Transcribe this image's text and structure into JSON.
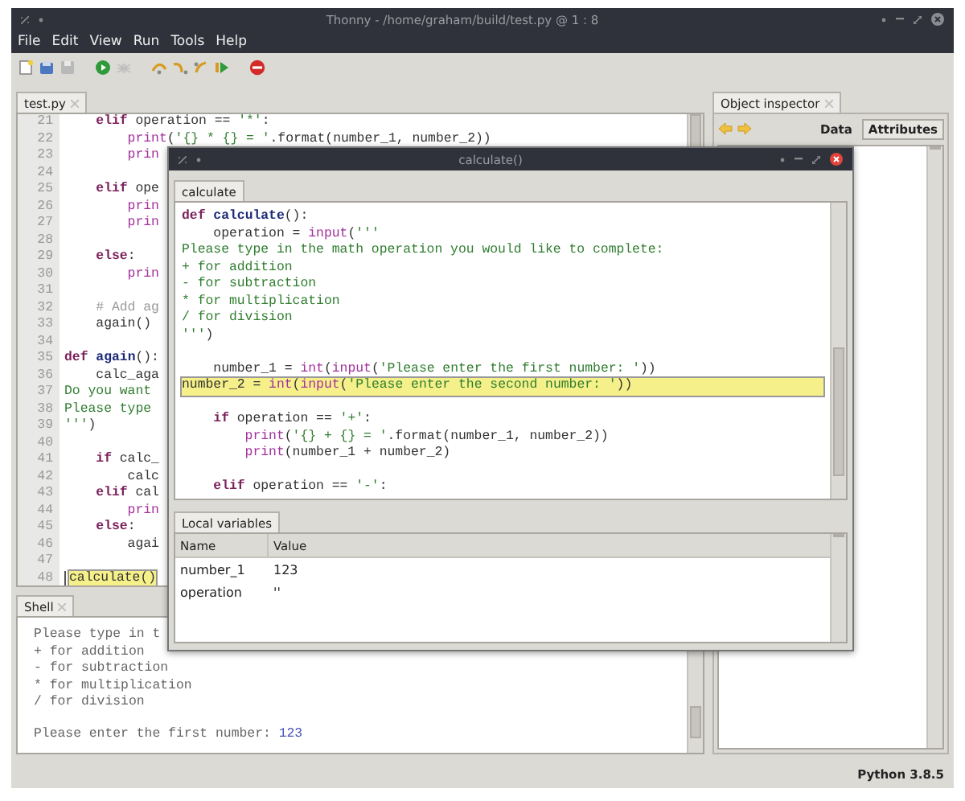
{
  "window": {
    "title": "Thonny - /home/graham/build/test.py @ 1 : 8"
  },
  "menu": [
    "File",
    "Edit",
    "View",
    "Run",
    "Tools",
    "Help"
  ],
  "editor": {
    "tab": "test.py",
    "lines": [
      {
        "number": "21",
        "highlighted": false,
        "tokens": [
          {
            "kind": "keyword",
            "text": "    elif"
          },
          {
            "kind": "plain",
            "text": " operation == "
          },
          {
            "kind": "string",
            "text": "'*'"
          },
          {
            "kind": "plain",
            "text": ":"
          }
        ]
      },
      {
        "number": "22",
        "highlighted": false,
        "tokens": [
          {
            "kind": "builtin",
            "text": "        print"
          },
          {
            "kind": "plain",
            "text": "("
          },
          {
            "kind": "string",
            "text": "'{} * {} = '"
          },
          {
            "kind": "plain",
            "text": ".format(number_1, number_2))"
          }
        ]
      },
      {
        "number": "23",
        "highlighted": false,
        "tokens": [
          {
            "kind": "builtin",
            "text": "        prin"
          }
        ]
      },
      {
        "number": "24",
        "highlighted": false
      },
      {
        "number": "25",
        "highlighted": false,
        "tokens": [
          {
            "kind": "keyword",
            "text": "    elif"
          },
          {
            "kind": "plain",
            "text": " ope"
          }
        ]
      },
      {
        "number": "26",
        "highlighted": false,
        "tokens": [
          {
            "kind": "builtin",
            "text": "        prin"
          }
        ]
      },
      {
        "number": "27",
        "highlighted": false,
        "tokens": [
          {
            "kind": "builtin",
            "text": "        prin"
          }
        ]
      },
      {
        "number": "28",
        "highlighted": false
      },
      {
        "number": "29",
        "highlighted": false,
        "tokens": [
          {
            "kind": "keyword",
            "text": "    else"
          },
          {
            "kind": "plain",
            "text": ":"
          }
        ]
      },
      {
        "number": "30",
        "highlighted": false,
        "tokens": [
          {
            "kind": "builtin",
            "text": "        prin"
          }
        ]
      },
      {
        "number": "31",
        "highlighted": false
      },
      {
        "number": "32",
        "highlighted": false,
        "tokens": [
          {
            "kind": "comment",
            "text": "    # Add ag"
          }
        ]
      },
      {
        "number": "33",
        "highlighted": false,
        "tokens": [
          {
            "kind": "plain",
            "text": "    again()"
          }
        ]
      },
      {
        "number": "34",
        "highlighted": false
      },
      {
        "number": "35",
        "highlighted": false,
        "tokens": [
          {
            "kind": "keyword",
            "text": "def"
          },
          {
            "kind": "defname",
            "text": " again"
          },
          {
            "kind": "plain",
            "text": "():"
          }
        ]
      },
      {
        "number": "36",
        "highlighted": false,
        "tokens": [
          {
            "kind": "plain",
            "text": "    calc_aga"
          }
        ]
      },
      {
        "number": "37",
        "highlighted": false,
        "tokens": [
          {
            "kind": "string",
            "text": "Do you want"
          }
        ]
      },
      {
        "number": "38",
        "highlighted": false,
        "tokens": [
          {
            "kind": "string",
            "text": "Please type"
          }
        ]
      },
      {
        "number": "39",
        "highlighted": false,
        "tokens": [
          {
            "kind": "string",
            "text": "'''"
          },
          {
            "kind": "plain",
            "text": ")"
          }
        ]
      },
      {
        "number": "40",
        "highlighted": false
      },
      {
        "number": "41",
        "highlighted": false,
        "tokens": [
          {
            "kind": "keyword",
            "text": "    if"
          },
          {
            "kind": "plain",
            "text": " calc_"
          }
        ]
      },
      {
        "number": "42",
        "highlighted": false,
        "tokens": [
          {
            "kind": "plain",
            "text": "        calc"
          }
        ]
      },
      {
        "number": "43",
        "highlighted": false,
        "tokens": [
          {
            "kind": "keyword",
            "text": "    elif"
          },
          {
            "kind": "plain",
            "text": " cal"
          }
        ]
      },
      {
        "number": "44",
        "highlighted": false,
        "tokens": [
          {
            "kind": "builtin",
            "text": "        prin"
          }
        ]
      },
      {
        "number": "45",
        "highlighted": false,
        "tokens": [
          {
            "kind": "keyword",
            "text": "    else"
          },
          {
            "kind": "plain",
            "text": ":"
          }
        ]
      },
      {
        "number": "46",
        "highlighted": false,
        "tokens": [
          {
            "kind": "plain",
            "text": "        agai"
          }
        ]
      },
      {
        "number": "47",
        "highlighted": false
      },
      {
        "number": "48",
        "highlighted": true,
        "tokens": [
          {
            "kind": "plain",
            "text": "calculate()"
          }
        ]
      }
    ]
  },
  "shell": {
    "tab": "Shell",
    "lines": [
      {
        "kind": "output",
        "text": "Please type in t"
      },
      {
        "kind": "output",
        "text": "+ for addition"
      },
      {
        "kind": "output",
        "text": "- for subtraction"
      },
      {
        "kind": "output",
        "text": "* for multiplication"
      },
      {
        "kind": "output",
        "text": "/ for division"
      },
      {
        "kind": "blank"
      },
      {
        "kind": "output",
        "text": "Please enter the first number: ",
        "input": "123"
      }
    ]
  },
  "object_inspector": {
    "tab": "Object inspector",
    "views": [
      {
        "label": "Data",
        "selected": false
      },
      {
        "label": "Attributes",
        "selected": true
      }
    ]
  },
  "status_bar": "Python 3.8.5",
  "frame_window": {
    "title": "calculate()",
    "tab": "calculate",
    "lines": [
      {
        "highlighted": false,
        "tokens": [
          {
            "kind": "keyword",
            "text": "def"
          },
          {
            "kind": "defname",
            "text": " calculate"
          },
          {
            "kind": "plain",
            "text": "():"
          }
        ]
      },
      {
        "highlighted": false,
        "tokens": [
          {
            "kind": "plain",
            "text": "    operation = "
          },
          {
            "kind": "builtin",
            "text": "input"
          },
          {
            "kind": "plain",
            "text": "("
          },
          {
            "kind": "string",
            "text": "'''"
          }
        ]
      },
      {
        "highlighted": false,
        "tokens": [
          {
            "kind": "string",
            "text": "Please type in the math operation you would like to complete:"
          }
        ]
      },
      {
        "highlighted": false,
        "tokens": [
          {
            "kind": "string",
            "text": "+ for addition"
          }
        ]
      },
      {
        "highlighted": false,
        "tokens": [
          {
            "kind": "string",
            "text": "- for subtraction"
          }
        ]
      },
      {
        "highlighted": false,
        "tokens": [
          {
            "kind": "string",
            "text": "* for multiplication"
          }
        ]
      },
      {
        "highlighted": false,
        "tokens": [
          {
            "kind": "string",
            "text": "/ for division"
          }
        ]
      },
      {
        "highlighted": false,
        "tokens": [
          {
            "kind": "string",
            "text": "'''"
          },
          {
            "kind": "plain",
            "text": ")"
          }
        ]
      },
      {
        "highlighted": false
      },
      {
        "highlighted": false,
        "tokens": [
          {
            "kind": "plain",
            "text": "    number_1 = "
          },
          {
            "kind": "builtin",
            "text": "int"
          },
          {
            "kind": "plain",
            "text": "("
          },
          {
            "kind": "builtin",
            "text": "input"
          },
          {
            "kind": "plain",
            "text": "("
          },
          {
            "kind": "string",
            "text": "'Please enter the first number: '"
          },
          {
            "kind": "plain",
            "text": "))"
          }
        ]
      },
      {
        "highlighted": true,
        "tokens": [
          {
            "kind": "plain",
            "text": "number_2 = "
          },
          {
            "kind": "builtin",
            "text": "int"
          },
          {
            "kind": "plain",
            "text": "("
          },
          {
            "kind": "builtin",
            "text": "input"
          },
          {
            "kind": "plain",
            "text": "("
          },
          {
            "kind": "string",
            "text": "'Please enter the second number: '"
          },
          {
            "kind": "plain",
            "text": "))"
          }
        ]
      },
      {
        "highlighted": false
      },
      {
        "highlighted": false,
        "tokens": [
          {
            "kind": "keyword",
            "text": "    if"
          },
          {
            "kind": "plain",
            "text": " operation == "
          },
          {
            "kind": "string",
            "text": "'+'"
          },
          {
            "kind": "plain",
            "text": ":"
          }
        ]
      },
      {
        "highlighted": false,
        "tokens": [
          {
            "kind": "builtin",
            "text": "        print"
          },
          {
            "kind": "plain",
            "text": "("
          },
          {
            "kind": "string",
            "text": "'{} + {} = '"
          },
          {
            "kind": "plain",
            "text": ".format(number_1, number_2))"
          }
        ]
      },
      {
        "highlighted": false,
        "tokens": [
          {
            "kind": "builtin",
            "text": "        print"
          },
          {
            "kind": "plain",
            "text": "(number_1 + number_2)"
          }
        ]
      },
      {
        "highlighted": false
      },
      {
        "highlighted": false,
        "tokens": [
          {
            "kind": "keyword",
            "text": "    elif"
          },
          {
            "kind": "plain",
            "text": " operation == "
          },
          {
            "kind": "string",
            "text": "'-'"
          },
          {
            "kind": "plain",
            "text": ":"
          }
        ]
      }
    ],
    "variables_tab": "Local variables",
    "variables": {
      "columns": [
        "Name",
        "Value"
      ],
      "rows": [
        [
          "number_1",
          "123"
        ],
        [
          "operation",
          "''"
        ]
      ]
    }
  }
}
